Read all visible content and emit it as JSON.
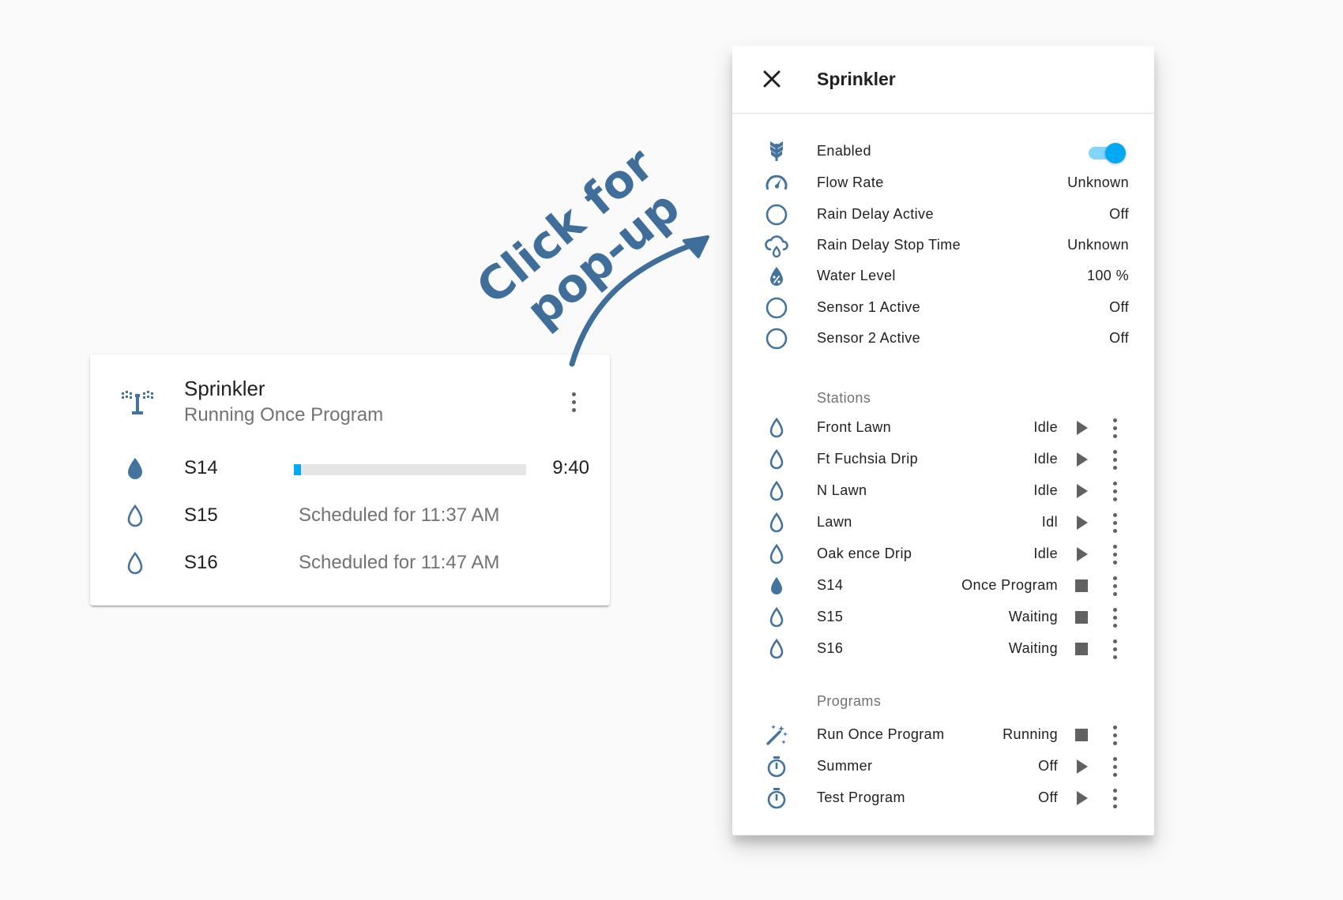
{
  "annotation": {
    "line1": "Click for",
    "line2": "pop-up"
  },
  "card": {
    "title": "Sprinkler",
    "subtitle": "Running Once Program",
    "icon": "sprinkler-icon",
    "rows": [
      {
        "name": "S14",
        "icon": "water-filled-icon",
        "progress_percent": 3,
        "time": "9:40"
      },
      {
        "name": "S15",
        "icon": "water-outline-icon",
        "status": "Scheduled for 11:37 AM"
      },
      {
        "name": "S16",
        "icon": "water-outline-icon",
        "status": "Scheduled for 11:47 AM"
      }
    ]
  },
  "dialog": {
    "title": "Sprinkler",
    "attributes": [
      {
        "label": "Enabled",
        "icon": "sprinkler-variant-icon",
        "toggle_on": true
      },
      {
        "label": "Flow Rate",
        "icon": "speedometer-icon",
        "value": "Unknown"
      },
      {
        "label": "Rain Delay Active",
        "icon": "circle-outline-icon",
        "value": "Off"
      },
      {
        "label": "Rain Delay Stop Time",
        "icon": "weather-pouring-icon",
        "value": "Unknown"
      },
      {
        "label": "Water Level",
        "icon": "water-percent-icon",
        "value": "100 %"
      },
      {
        "label": "Sensor 1 Active",
        "icon": "circle-outline-icon",
        "value": "Off"
      },
      {
        "label": "Sensor 2 Active",
        "icon": "circle-outline-icon",
        "value": "Off"
      }
    ],
    "stations_label": "Stations",
    "stations": [
      {
        "name": "Front Lawn",
        "state": "Idle",
        "action": "play",
        "icon": "water-outline-icon"
      },
      {
        "name": "Ft Fuchsia Drip",
        "state": "Idle",
        "action": "play",
        "icon": "water-outline-icon"
      },
      {
        "name": "N Lawn",
        "state": "Idle",
        "action": "play",
        "icon": "water-outline-icon"
      },
      {
        "name": "Lawn",
        "state": "Idl",
        "action": "play",
        "icon": "water-outline-icon"
      },
      {
        "name": "Oak ence Drip",
        "state": "Idle",
        "action": "play",
        "icon": "water-outline-icon"
      },
      {
        "name": "S14",
        "state": "Once Program",
        "action": "stop",
        "icon": "water-filled-icon"
      },
      {
        "name": "S15",
        "state": "Waiting",
        "action": "stop",
        "icon": "water-outline-icon"
      },
      {
        "name": "S16",
        "state": "Waiting",
        "action": "stop",
        "icon": "water-outline-icon"
      }
    ],
    "programs_label": "Programs",
    "programs": [
      {
        "name": "Run Once Program",
        "state": "Running",
        "action": "stop",
        "icon": "auto-fix-icon"
      },
      {
        "name": "Summer",
        "state": "Off",
        "action": "play",
        "icon": "timer-outline-icon"
      },
      {
        "name": "Test Program",
        "state": "Off",
        "action": "play",
        "icon": "timer-outline-icon"
      }
    ]
  },
  "colors": {
    "icon": "#44739e",
    "accent": "#03a9f4",
    "text_primary": "#212121",
    "text_secondary": "#727272",
    "annotation": "#3f6e9a"
  }
}
